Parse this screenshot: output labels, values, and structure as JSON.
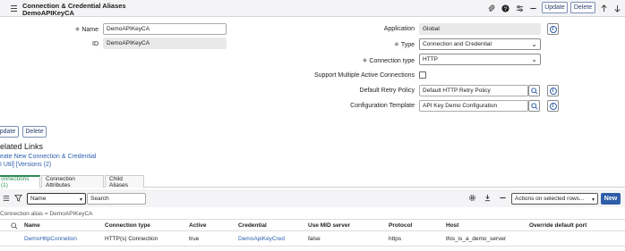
{
  "header": {
    "title_line1": "Connection & Credential Aliases",
    "title_line2": "DemoAPIKeyCA",
    "update_label": "Update",
    "delete_label": "Delete"
  },
  "form": {
    "name_label": "Name",
    "name_value": "DemoAPIKeyCA",
    "id_label": "ID",
    "id_value": "DemoAPIKeyCA",
    "application_label": "Application",
    "application_value": "Global",
    "type_label": "Type",
    "type_value": "Connection and Credential",
    "connection_type_label": "Connection type",
    "connection_type_value": "HTTP",
    "multi_active_label": "Support Multiple Active Connections",
    "retry_policy_label": "Default Retry Policy",
    "retry_policy_value": "Default HTTP Retry Policy",
    "config_template_label": "Configuration Template",
    "config_template_value": "API Key Demo Configuration",
    "required_mark": "✳"
  },
  "bottom_buttons": {
    "update_label": "pdate",
    "delete_label": "Delete"
  },
  "related": {
    "heading": "elated Links",
    "link1": "eate New Connection & Credential",
    "link2": "I Util] [Versions (2)"
  },
  "tabs": [
    {
      "label": "onnections (1)"
    },
    {
      "label": "Connection Attributes"
    },
    {
      "label": "Child Aliases"
    }
  ],
  "listbar": {
    "filter_select": "Name",
    "search_placeholder": "Search",
    "actions_select": "Actions on selected rows...",
    "new_label": "New"
  },
  "breadcrumb": "Connection alias = DemoAPIKeyCA",
  "table": {
    "columns": [
      "Name",
      "Connection type",
      "Active",
      "Credential",
      "Use MID server",
      "Protocol",
      "Host",
      "Override default port"
    ],
    "rows": [
      [
        "DemoHttpConnetion",
        "HTTP(s) Connection",
        "true",
        "DemoApiKeyCred",
        "false",
        "https",
        "this_is_a_demo_server",
        ""
      ]
    ]
  },
  "colors": {
    "accent": "#2f5ea9",
    "link": "#2d5fad",
    "active_tab": "#2d8a55"
  }
}
